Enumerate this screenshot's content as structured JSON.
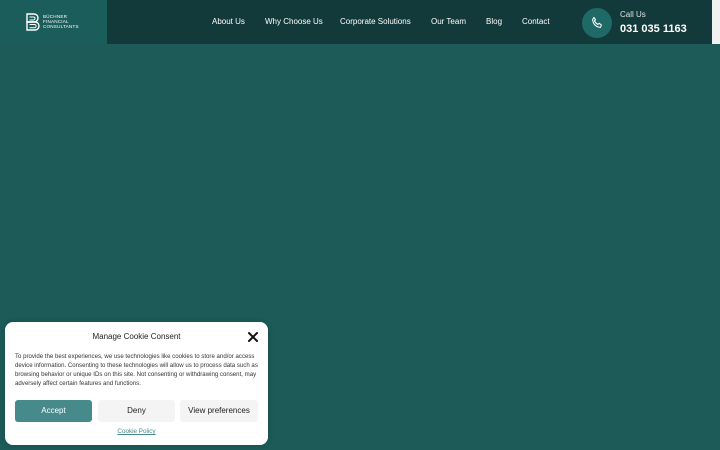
{
  "brand": {
    "lines": [
      "BÜCHNER",
      "FINANCIAL",
      "CONSULTANTS"
    ]
  },
  "nav": {
    "items": [
      {
        "label": "About Us"
      },
      {
        "label": "Why Choose Us"
      },
      {
        "label": "Corporate Solutions"
      },
      {
        "label": "Our Team"
      },
      {
        "label": "Blog"
      },
      {
        "label": "Contact"
      }
    ]
  },
  "call": {
    "label": "Call Us",
    "number": "031 035 1163",
    "icon": "phone-icon"
  },
  "cookie": {
    "title": "Manage Cookie Consent",
    "text": "To provide the best experiences, we use technologies like cookies to store and/or access device information. Consenting to these technologies will allow us to process data such as browsing behavior or unique IDs on this site. Not consenting or withdrawing consent, may adversely affect certain features and functions.",
    "accept_label": "Accept",
    "deny_label": "Deny",
    "prefs_label": "View preferences",
    "policy_label": "Cookie Policy",
    "close_icon": "close-icon"
  },
  "colors": {
    "page_bg": "#1c5b58",
    "header_bg": "#133a3a",
    "accent": "#478a8c"
  }
}
